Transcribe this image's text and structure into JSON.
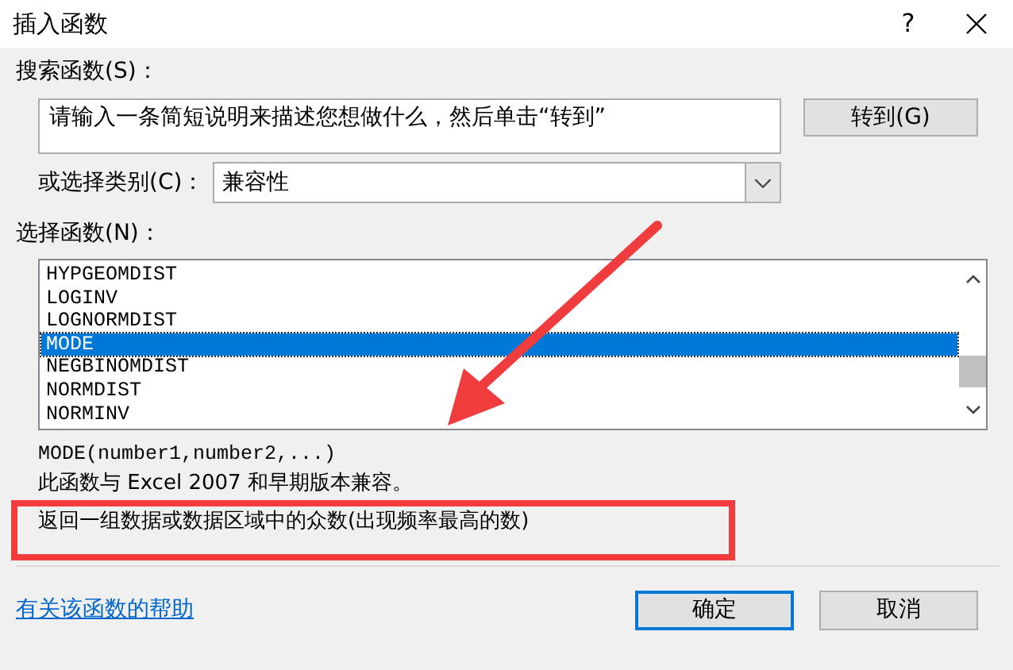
{
  "window": {
    "title": "插入函数",
    "help": "?"
  },
  "search": {
    "label": "搜索函数(S)：",
    "value": "请输入一条简短说明来描述您想做什么，然后单击“转到”",
    "button": "转到(G)"
  },
  "category": {
    "label": "或选择类别(C)：",
    "value": "兼容性"
  },
  "function_list": {
    "label": "选择函数(N)：",
    "items": [
      {
        "name": "HYPGEOMDIST",
        "selected": false
      },
      {
        "name": "LOGINV",
        "selected": false
      },
      {
        "name": "LOGNORMDIST",
        "selected": false
      },
      {
        "name": "MODE",
        "selected": true
      },
      {
        "name": "NEGBINOMDIST",
        "selected": false
      },
      {
        "name": "NORMDIST",
        "selected": false
      },
      {
        "name": "NORMINV",
        "selected": false
      }
    ]
  },
  "signature": "MODE(number1,number2,...)",
  "description": [
    "此函数与 Excel 2007 和早期版本兼容。",
    "返回一组数据或数据区域中的众数(出现频率最高的数)"
  ],
  "help_link": "有关该函数的帮助",
  "buttons": [
    {
      "label": "确定",
      "default": true
    },
    {
      "label": "取消",
      "default": false
    }
  ]
}
